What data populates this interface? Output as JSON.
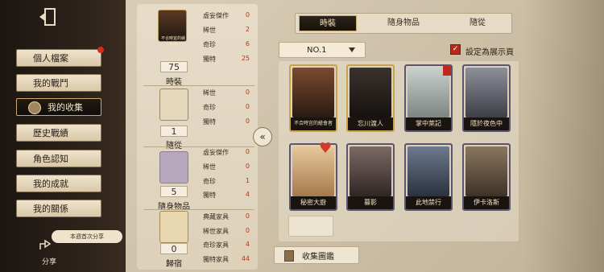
{
  "sidebar": {
    "menu": [
      {
        "label": "個人檔案",
        "has_red_dot": true
      },
      {
        "label": "我的戰鬥"
      },
      {
        "label": "我的收集",
        "active": true
      },
      {
        "label": "歷史戰績"
      },
      {
        "label": "角色認知"
      },
      {
        "label": "我的成就"
      },
      {
        "label": "我的關係"
      }
    ],
    "share_prompt": "本週首次分享",
    "share_label": "分享",
    "icons": {
      "exit": "exit-door-icon",
      "share": "share-icon",
      "collection": "collection-badge-icon"
    }
  },
  "stats": {
    "featured_card_title": "不合時宜的繪會者",
    "categories": [
      {
        "count": "75",
        "label": "時裝",
        "rows": [
          {
            "label": "虛妄傑作",
            "value": "0"
          },
          {
            "label": "稀世",
            "value": "2"
          },
          {
            "label": "奇珍",
            "value": "6"
          },
          {
            "label": "獨特",
            "value": "25"
          }
        ]
      },
      {
        "count": "1",
        "label": "隨從",
        "rows": [
          {
            "label": "稀世",
            "value": "0"
          },
          {
            "label": "奇珍",
            "value": "0"
          },
          {
            "label": "獨特",
            "value": "0"
          }
        ]
      },
      {
        "count": "5",
        "label": "隨身物品",
        "rows": [
          {
            "label": "虛妄傑作",
            "value": "0"
          },
          {
            "label": "稀世",
            "value": "0"
          },
          {
            "label": "奇珍",
            "value": "1"
          },
          {
            "label": "獨特",
            "value": "4"
          }
        ]
      },
      {
        "count": "0",
        "label": "歸宿",
        "rows": [
          {
            "label": "典藏家具",
            "value": "0"
          },
          {
            "label": "稀世家具",
            "value": "0"
          },
          {
            "label": "奇珍家具",
            "value": "4"
          },
          {
            "label": "獨特家具",
            "value": "44"
          }
        ]
      }
    ]
  },
  "tabs": [
    {
      "label": "時裝",
      "active": true
    },
    {
      "label": "隨身物品"
    },
    {
      "label": "隨從"
    }
  ],
  "dropdown": {
    "value": "NO.1"
  },
  "showcase": {
    "label": "設定為展示頁",
    "checked": true
  },
  "cards": [
    {
      "name": "不合時宜的繪會者",
      "frame": "gold",
      "art": "#5a3322"
    },
    {
      "name": "忘川渡人",
      "frame": "gold",
      "art": "#2a2420"
    },
    {
      "name": "掌中萊記",
      "frame": "purple",
      "art": "#9ea7a4",
      "flag": true
    },
    {
      "name": "隱於夜色中",
      "frame": "purple",
      "art": "#6a6d78"
    },
    {
      "name": "秘密大廚",
      "frame": "purple",
      "art": "#c99f6a",
      "heart": true
    },
    {
      "name": "暮影",
      "frame": "purple",
      "art": "#5c4c48"
    },
    {
      "name": "此地禁行",
      "frame": "purple",
      "art": "#4a5466"
    },
    {
      "name": "伊卡洛斯",
      "frame": "purple",
      "art": "#6b5a48"
    }
  ],
  "gallery_button": "收集圖鑑",
  "collapse_glyph": "«"
}
